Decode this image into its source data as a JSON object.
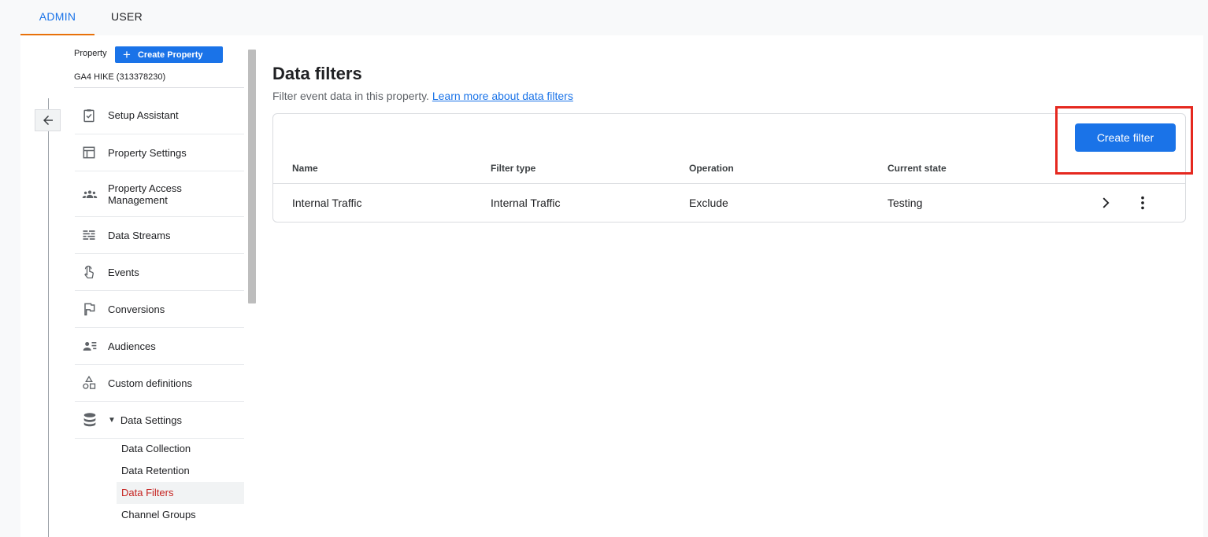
{
  "tabs": [
    {
      "label": "ADMIN",
      "active": true
    },
    {
      "label": "USER",
      "active": false
    }
  ],
  "property": {
    "label": "Property",
    "create_button": "Create Property",
    "name": "GA4 HIKE (313378230)"
  },
  "sidebar": {
    "items": [
      {
        "label": "Setup Assistant",
        "icon": "clipboard-check-icon"
      },
      {
        "label": "Property Settings",
        "icon": "layout-icon"
      },
      {
        "label": "Property Access Management",
        "icon": "people-icon"
      },
      {
        "label": "Data Streams",
        "icon": "streams-icon"
      },
      {
        "label": "Events",
        "icon": "touch-icon"
      },
      {
        "label": "Conversions",
        "icon": "flag-icon"
      },
      {
        "label": "Audiences",
        "icon": "audience-icon"
      },
      {
        "label": "Custom definitions",
        "icon": "shapes-icon"
      },
      {
        "label": "Data Settings",
        "icon": "database-icon"
      }
    ],
    "sub_items": [
      {
        "label": "Data Collection",
        "active": false
      },
      {
        "label": "Data Retention",
        "active": false
      },
      {
        "label": "Data Filters",
        "active": true
      },
      {
        "label": "Channel Groups",
        "active": false
      }
    ]
  },
  "main": {
    "title": "Data filters",
    "subtitle": "Filter event data in this property.",
    "learn_more": "Learn more about data filters",
    "create_filter": "Create filter",
    "table": {
      "headers": [
        "Name",
        "Filter type",
        "Operation",
        "Current state"
      ],
      "rows": [
        [
          "Internal Traffic",
          "Internal Traffic",
          "Exclude",
          "Testing"
        ]
      ]
    }
  },
  "colors": {
    "accent": "#1a73e8",
    "tab_underline": "#e8710a",
    "highlight": "#e5281f",
    "active_sub": "#c5221f"
  }
}
